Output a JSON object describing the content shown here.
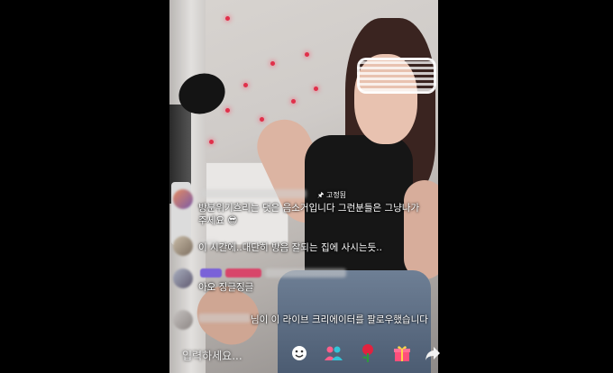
{
  "pinned": {
    "label": "고정됨",
    "text": "방분위기흐리는 댓은 음소거입니다 그런분들은 그냥나가주세요 😎"
  },
  "messages": [
    {
      "text": "이 시간에..대단히 방음 잘되는 집에 사시는듯.."
    },
    {
      "text": "아오 징글징글"
    },
    {
      "text": "님이 이 라이브 크리에이터를 팔로우했습니다"
    }
  ],
  "input": {
    "placeholder": "입력하세요..."
  },
  "icons": {
    "pin": "pin-icon",
    "emoji": "emoji-icon",
    "people": "people-icon",
    "rose": "rose-icon",
    "gift": "gift-icon",
    "share": "share-icon"
  },
  "colors": {
    "background": "#000000",
    "accent": "#e0304a"
  }
}
